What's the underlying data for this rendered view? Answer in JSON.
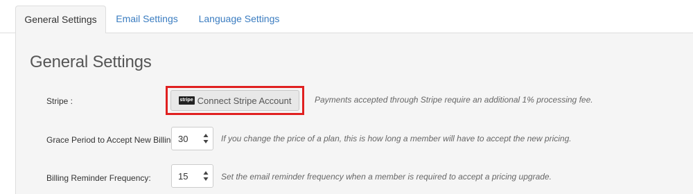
{
  "tabs": [
    {
      "label": "General Settings",
      "active": true
    },
    {
      "label": "Email Settings",
      "active": false
    },
    {
      "label": "Language Settings",
      "active": false
    }
  ],
  "section_title": "General Settings",
  "stripe": {
    "label": "Stripe :",
    "button_icon_text": "stripe",
    "button_label": "Connect Stripe Account",
    "hint": "Payments accepted through Stripe require an additional 1% processing fee."
  },
  "grace_period": {
    "label": "Grace Period to Accept New Billing:",
    "value": "30",
    "hint": "If you change the price of a plan, this is how long a member will have to accept the new pricing."
  },
  "reminder": {
    "label": "Billing Reminder Frequency:",
    "value": "15",
    "hint": "Set the email reminder frequency when a member is required to accept a pricing upgrade."
  },
  "icons": {
    "stripe": "stripe-logo-icon",
    "stepper_arrows": "up-down-arrows-icon"
  },
  "colors": {
    "link": "#3a7cc0",
    "highlight": "#e02020",
    "panel_bg": "#f5f5f5"
  }
}
